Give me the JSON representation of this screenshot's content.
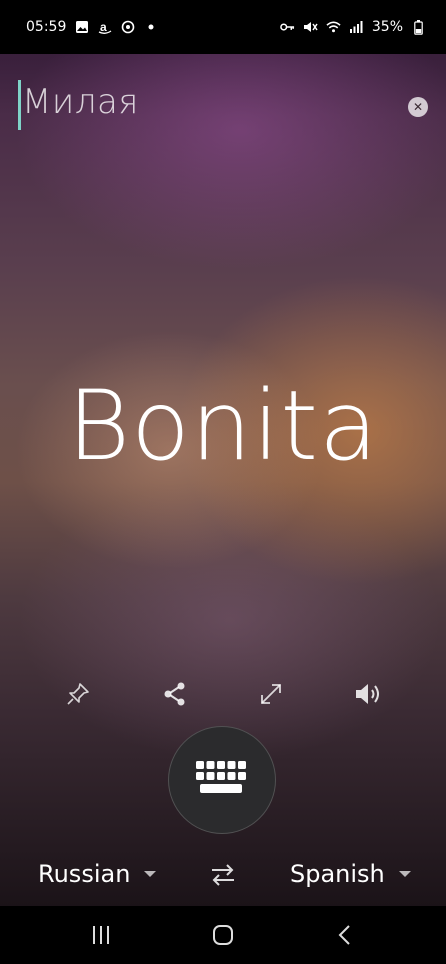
{
  "status_bar": {
    "time": "05:59",
    "battery": "35%",
    "left_icons": [
      "gallery-icon",
      "amazon-icon",
      "sync-icon",
      "dot-icon"
    ],
    "right_icons": [
      "key-icon",
      "mute-icon",
      "wifi-icon",
      "signal-icon",
      "battery-icon"
    ]
  },
  "input": {
    "value": "Милая"
  },
  "translation": {
    "text": "Bonita"
  },
  "actions": [
    "pin-icon",
    "share-icon",
    "expand-icon",
    "speaker-icon"
  ],
  "languages": {
    "source": "Russian",
    "target": "Spanish"
  },
  "nav": [
    "recents-icon",
    "home-icon",
    "back-icon"
  ],
  "colors": {
    "cursor": "#7fd4c8",
    "keyboard_button": "#2b2b2d"
  }
}
